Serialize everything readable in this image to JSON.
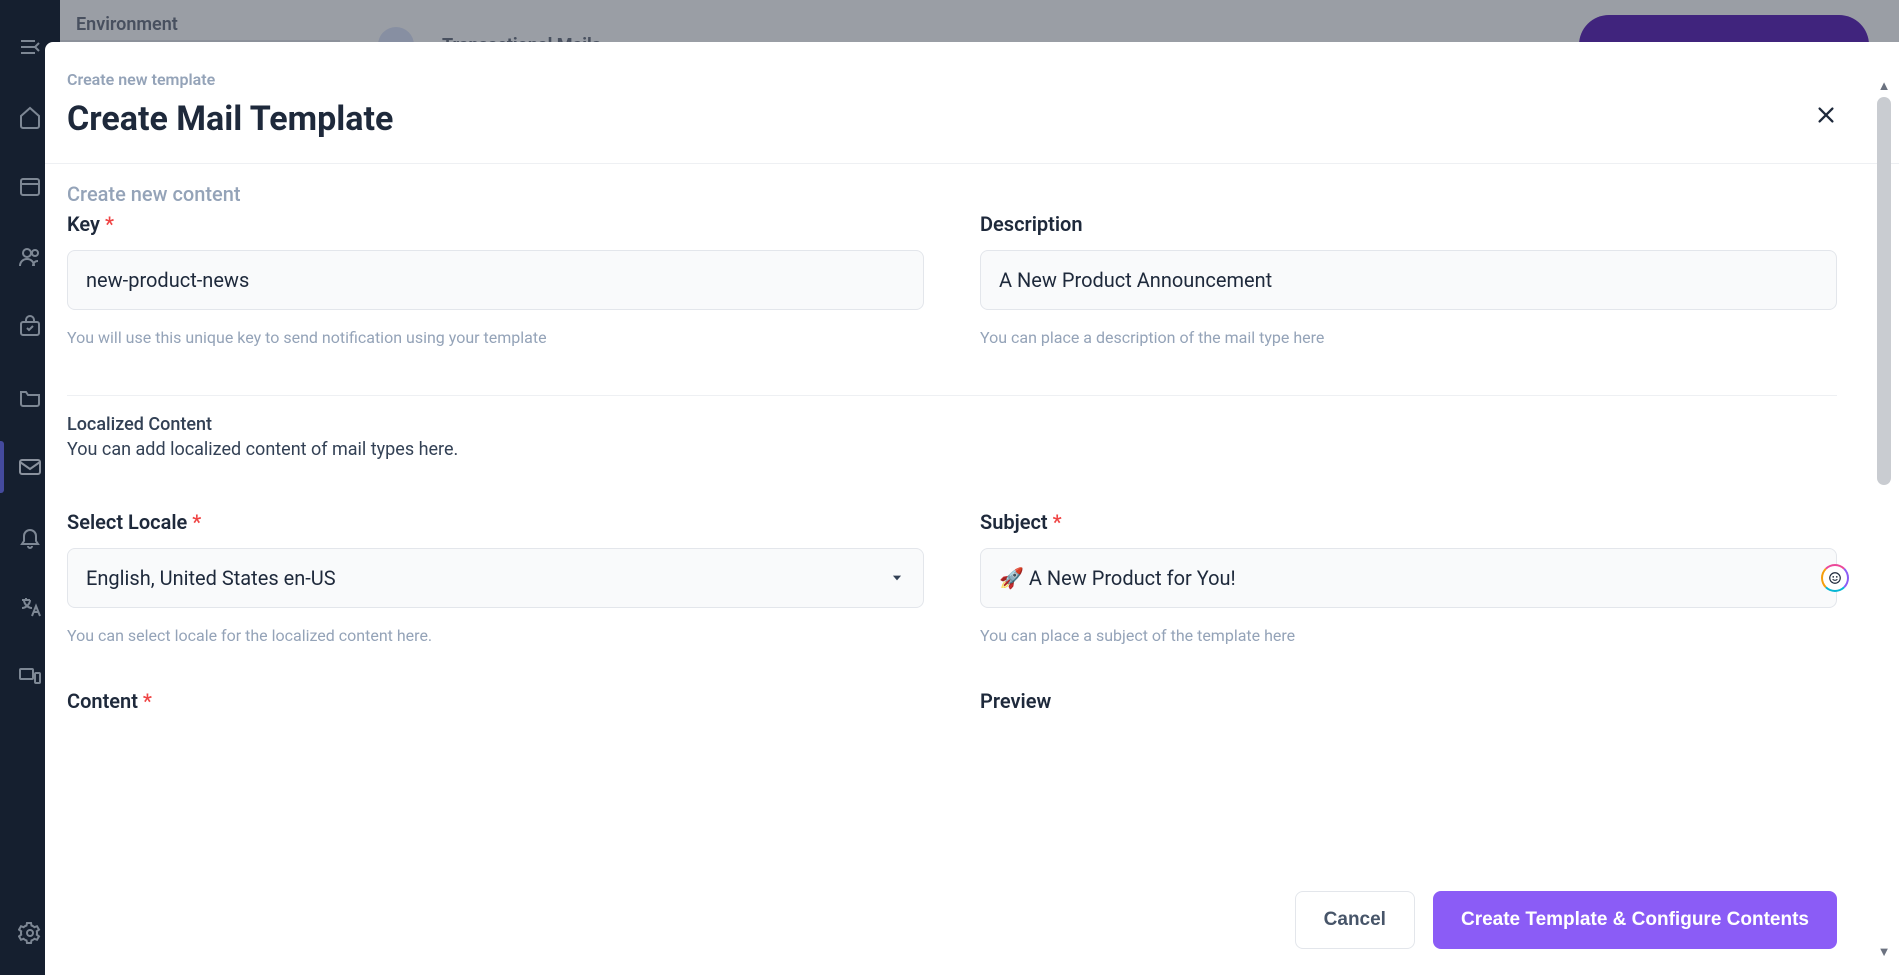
{
  "bg": {
    "env_label": "Environment",
    "header_title": "Transactional Mails"
  },
  "modal": {
    "breadcrumb": "Create new template",
    "title": "Create Mail Template",
    "section1_heading": "Create new content",
    "key": {
      "label": "Key",
      "value": "new-product-news",
      "helper": "You will use this unique key to send notification using your template"
    },
    "description": {
      "label": "Description",
      "value": "A New Product Announcement",
      "helper": "You can place a description of the mail type here"
    },
    "localized": {
      "heading": "Localized Content",
      "desc": "You can add localized content of mail types here."
    },
    "locale": {
      "label": "Select Locale",
      "value": "English, United States en-US",
      "helper": "You can select locale for the localized content here."
    },
    "subject": {
      "label": "Subject",
      "value": "🚀 A New Product for You!",
      "helper": "You can place a subject of the template here"
    },
    "content_label": "Content",
    "preview_label": "Preview",
    "cancel": "Cancel",
    "submit": "Create Template & Configure Contents"
  }
}
